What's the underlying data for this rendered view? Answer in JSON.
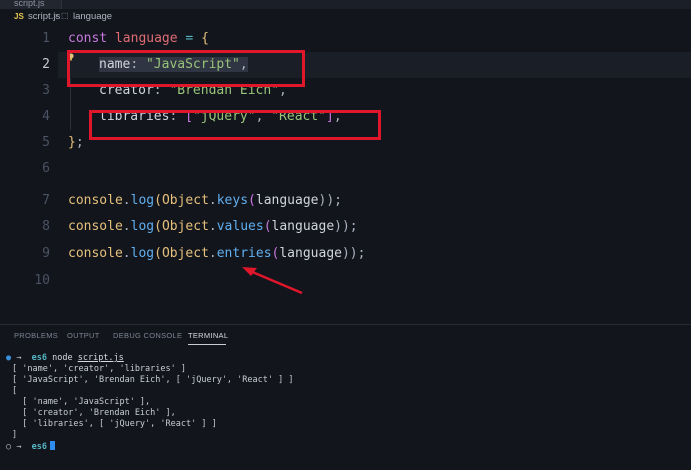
{
  "tab": {
    "filename": "script.js"
  },
  "breadcrumb": {
    "file_type": "JS",
    "file": "script.js",
    "separator": ">",
    "symbol": "language"
  },
  "editor": {
    "line_numbers": [
      "1",
      "2",
      "3",
      "4",
      "5",
      "6",
      "7",
      "8",
      "9",
      "10"
    ],
    "active_line": "2",
    "code": {
      "l1": {
        "kw": "const",
        "var": "language",
        "op": "=",
        "brace": "{"
      },
      "l2": {
        "prop": "name",
        "colon": ":",
        "value": "\"JavaScript\"",
        "comma": ","
      },
      "l3": {
        "prop": "creator",
        "colon": ":",
        "value": "\"Brendan Eich\"",
        "comma": ","
      },
      "l4": {
        "prop": "libraries",
        "colon": ":",
        "open": "[",
        "v1": "\"jQuery\"",
        "sep": ",",
        "v2": "\"React\"",
        "close": "]",
        "comma": ","
      },
      "l5": {
        "brace": "}",
        "semi": ";"
      },
      "l7": {
        "obj": "console",
        "dot": ".",
        "fn": "log",
        "open": "(",
        "obj2": "Object",
        "dot2": ".",
        "method": "keys",
        "open2": "(",
        "arg": "language",
        "close": "));"
      },
      "l8": {
        "obj": "console",
        "dot": ".",
        "fn": "log",
        "open": "(",
        "obj2": "Object",
        "dot2": ".",
        "method": "values",
        "open2": "(",
        "arg": "language",
        "close": "));"
      },
      "l9": {
        "obj": "console",
        "dot": ".",
        "fn": "log",
        "open": "(",
        "obj2": "Object",
        "dot2": ".",
        "method": "entries",
        "open2": "(",
        "arg": "language",
        "close": "));"
      }
    }
  },
  "panel": {
    "tabs": [
      "PROBLEMS",
      "OUTPUT",
      "DEBUG CONSOLE",
      "TERMINAL"
    ],
    "active_tab": "TERMINAL"
  },
  "terminal": {
    "prompt_symbol": "●",
    "prompt_arrow": "→",
    "cwd": "es6",
    "command": "node",
    "command_arg": "script.js",
    "lines": [
      "[ 'name', 'creator', 'libraries' ]",
      "[ 'JavaScript', 'Brendan Eich', [ 'jQuery', 'React' ] ]",
      "[",
      "  [ 'name', 'JavaScript' ],",
      "  [ 'creator', 'Brendan Eich' ],",
      "  [ 'libraries', [ 'jQuery', 'React' ] ]",
      "]"
    ],
    "prompt2_symbol": "○",
    "prompt2_arrow": "→",
    "cwd2": "es6"
  },
  "colors": {
    "annotation_red": "#e0162b",
    "cursor_blue": "#2f8df0",
    "background": "#12151c"
  },
  "icons": {
    "lightbulb": "lightbulb-icon",
    "braces": "symbol-object-icon"
  }
}
